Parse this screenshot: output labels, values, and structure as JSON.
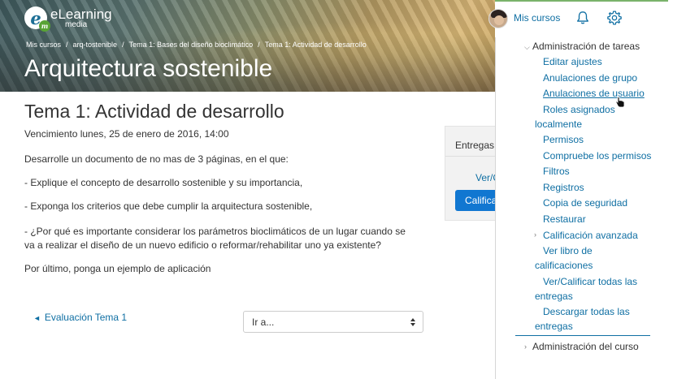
{
  "logo": {
    "brand": "eLearning",
    "sub": "media",
    "mark": "e",
    "mark_m": "m"
  },
  "breadcrumb": [
    "Mis cursos",
    "arq-tostenible",
    "Tema 1: Bases del diseño bioclimático",
    "Tema 1: Actividad de desarrollo"
  ],
  "breadcrumb_sep": "/",
  "course_title": "Arquitectura sostenible",
  "header": {
    "mis_cursos": "Mis cursos"
  },
  "activity": {
    "title": "Tema 1: Actividad de desarrollo",
    "due": "Vencimiento lunes, 25 de enero de 2016, 14:00",
    "paragraphs": [
      "Desarrolle un documento de no mas de 3 páginas, en el que:",
      "- Explique el concepto de desarrollo sostenible y su importancia,",
      "- Exponga los criterios que debe cumplir la arquitectura sostenible,",
      "- ¿Por qué es importante considerar los parámetros bioclimáticos de un lugar cuando se va a realizar el diseño de un nuevo edificio o reformar/rehabilitar uno ya existente?",
      "Por último, ponga un ejemplo de aplicación"
    ]
  },
  "submissions": {
    "label": "Entregas:",
    "view_link": "Ver/C",
    "grade_button": "Calificar"
  },
  "nav": {
    "prev": "Evaluación Tema 1",
    "prev_icon": "◄",
    "jump_placeholder": "Ir a..."
  },
  "drawer": {
    "heading": "Administración de tareas",
    "items": {
      "edit": "Editar ajustes",
      "group_overrides": "Anulaciones de grupo",
      "user_overrides": "Anulaciones de usuario",
      "roles": "Roles asignados localmente",
      "permissions": "Permisos",
      "check_permissions": "Compruebe los permisos",
      "filters": "Filtros",
      "logs": "Registros",
      "backup": "Copia de seguridad",
      "restore": "Restaurar",
      "advanced_grading": "Calificación avanzada",
      "gradebook": "Ver libro de calificaciones",
      "view_all": "Ver/Calificar todas las entregas",
      "download_all": "Descargar todas las entregas"
    },
    "course_admin": "Administración del curso"
  },
  "colors": {
    "link": "#0f6fa3",
    "button": "#1177d1",
    "top_accent": "#7ab36a"
  }
}
